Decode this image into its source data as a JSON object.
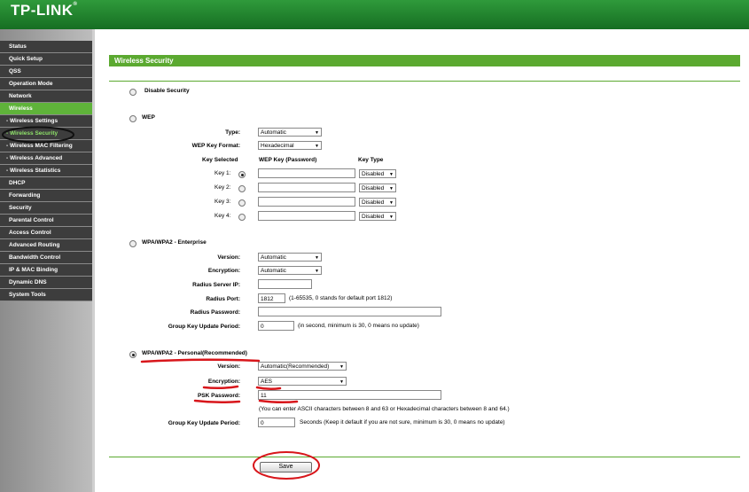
{
  "brand": {
    "logo": "TP-LINK",
    "reg": "®"
  },
  "menu": [
    {
      "label": "Status"
    },
    {
      "label": "Quick Setup"
    },
    {
      "label": "QSS"
    },
    {
      "label": "Operation Mode"
    },
    {
      "label": "Network"
    },
    {
      "label": "Wireless"
    },
    {
      "label": "- Wireless Settings"
    },
    {
      "label": "- Wireless Security"
    },
    {
      "label": "- Wireless MAC Filtering"
    },
    {
      "label": "- Wireless Advanced"
    },
    {
      "label": "- Wireless Statistics"
    },
    {
      "label": "DHCP"
    },
    {
      "label": "Forwarding"
    },
    {
      "label": "Security"
    },
    {
      "label": "Parental Control"
    },
    {
      "label": "Access Control"
    },
    {
      "label": "Advanced Routing"
    },
    {
      "label": "Bandwidth Control"
    },
    {
      "label": "IP & MAC Binding"
    },
    {
      "label": "Dynamic DNS"
    },
    {
      "label": "System Tools"
    }
  ],
  "section_title": "Wireless Security",
  "disable": {
    "label": "Disable Security"
  },
  "wep": {
    "label": "WEP",
    "type_label": "Type:",
    "type_value": "Automatic",
    "format_label": "WEP Key Format:",
    "format_value": "Hexadecimal",
    "col_key_selected": "Key Selected",
    "col_key": "WEP Key (Password)",
    "col_type": "Key Type",
    "keys": [
      {
        "label": "Key 1:",
        "type": "Disabled"
      },
      {
        "label": "Key 2:",
        "type": "Disabled"
      },
      {
        "label": "Key 3:",
        "type": "Disabled"
      },
      {
        "label": "Key 4:",
        "type": "Disabled"
      }
    ]
  },
  "ent": {
    "label": "WPA/WPA2 - Enterprise",
    "version_label": "Version:",
    "version_value": "Automatic",
    "enc_label": "Encryption:",
    "enc_value": "Automatic",
    "rip_label": "Radius Server IP:",
    "rport_label": "Radius Port:",
    "rport_value": "1812",
    "rport_hint": "(1-65535, 0 stands for default port 1812)",
    "rpw_label": "Radius Password:",
    "gkup_label": "Group Key Update Period:",
    "gkup_value": "0",
    "gkup_hint": "(in second, minimum is 30, 0 means no update)"
  },
  "personal": {
    "label": "WPA/WPA2 - Personal(Recommended)",
    "version_label": "Version:",
    "version_value": "Automatic(Recommended)",
    "enc_label": "Encryption:",
    "enc_value": "AES",
    "psk_label": "PSK Password:",
    "psk_value": "11",
    "psk_hint": "(You can enter ASCII characters between 8 and 63 or Hexadecimal characters between 8 and 64.)",
    "gkup_label": "Group Key Update Period:",
    "gkup_value": "0",
    "gkup_hint": "Seconds (Keep it default if you are not sure, minimum is 30, 0 means no update)"
  },
  "save_label": "Save",
  "colors": {
    "header": "#1e7a2a",
    "accent": "#5ba930",
    "menu": "#3d3d3d",
    "annotation": "#d8161b"
  }
}
